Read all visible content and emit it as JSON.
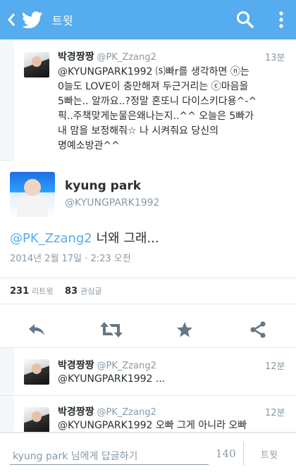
{
  "topbar": {
    "title": "트윗",
    "color": "#55acee"
  },
  "context_tweet": {
    "name": "박경짱짱",
    "handle": "@PK_Zzang2",
    "time": "13분",
    "text": "@KYUNGPARK1992 ⒮빠r를 생각하면 ⓝ는\n0늘도 LOVE이 충만해져 두근거리는 ⓒ마음을\n5빠는.. 알까요..?정말 혼또니 다이스키다용^-^\n픽..주책맞게눈물은왜나는지..^^ 오늘은 5빠가\n내 맘을 보정해줘☆ 나 시켜줘요 당신의\n명예소방관^^"
  },
  "main_tweet": {
    "name": "kyung park",
    "handle": "@KYUNGPARK1992",
    "mention": "@PK_Zzang2",
    "text": " 너왜 그래...",
    "date": "2014년 2월 17일 · 2:23 오전",
    "retweets_count": "231",
    "retweets_label": "리트윗",
    "favorites_count": "83",
    "favorites_label": "관심글"
  },
  "replies": [
    {
      "name": "박경짱짱",
      "handle": "@PK_Zzang2",
      "time": "12분",
      "text": "@KYUNGPARK1992 ..."
    },
    {
      "name": "박경짱짱",
      "handle": "@PK_Zzang2",
      "time": "12분",
      "text": "@KYUNGPARK1992 오빠 그게 아니라 오빠"
    }
  ],
  "composer": {
    "placeholder": "kyung park 님에게 답글하기",
    "char_count": "140",
    "send_label": "트윗"
  },
  "icons": {
    "back": "chevron-left-icon",
    "logo": "twitter-bird-icon",
    "search": "search-icon",
    "menu": "overflow-menu-icon",
    "reply": "reply-icon",
    "retweet": "retweet-icon",
    "favorite": "star-icon",
    "share": "share-icon"
  }
}
